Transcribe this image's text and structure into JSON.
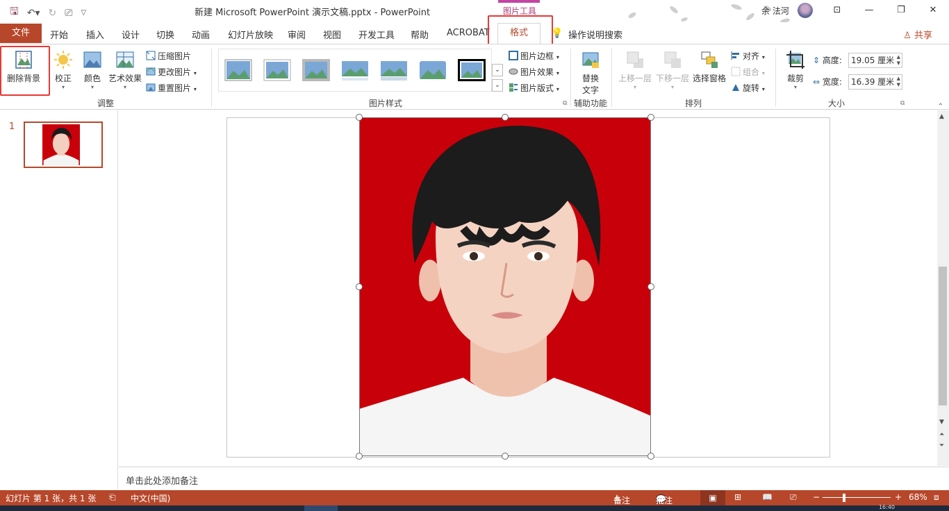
{
  "titlebar": {
    "title": "新建 Microsoft PowerPoint 演示文稿.pptx  -  PowerPoint",
    "context_group": "图片工具",
    "user": "余 法河",
    "qat": {
      "save": "🖫",
      "undo": "↶▾",
      "redo": "↻",
      "present": "⎚",
      "customize": "▽"
    },
    "window": {
      "options": "⊡",
      "minimize": "—",
      "restore": "❐",
      "close": "✕"
    }
  },
  "tabs": {
    "file": "文件",
    "items": [
      "开始",
      "插入",
      "设计",
      "切换",
      "动画",
      "幻灯片放映",
      "审阅",
      "视图",
      "开发工具",
      "帮助",
      "ACROBAT"
    ],
    "active": "格式",
    "tell_me": "操作说明搜索",
    "share": "共享"
  },
  "ribbon": {
    "adjust": {
      "label": "调整",
      "remove_bg": "删除背景",
      "corrections": "校正",
      "color": "颜色",
      "artistic": "艺术效果",
      "compress": "压缩图片",
      "change": "更改图片",
      "reset": "重置图片"
    },
    "styles": {
      "label": "图片样式",
      "border": "图片边框",
      "effects": "图片效果",
      "layout": "图片版式"
    },
    "accessibility": {
      "label": "辅助功能",
      "alt_text_1": "替换",
      "alt_text_2": "文字"
    },
    "arrange": {
      "label": "排列",
      "bring_forward": "上移一层",
      "send_backward": "下移一层",
      "selection_pane": "选择窗格",
      "align": "对齐",
      "group": "组合",
      "rotate": "旋转"
    },
    "size": {
      "label": "大小",
      "crop": "裁剪",
      "height_label": "高度:",
      "height_value": "19.05 厘米",
      "width_label": "宽度:",
      "width_value": "16.39 厘米"
    }
  },
  "slides_panel": {
    "slide_number": "1"
  },
  "notes": {
    "placeholder": "单击此处添加备注"
  },
  "status": {
    "slide_info": "幻灯片 第 1 张，共 1 张",
    "language": "中文(中国)",
    "notes": "备注",
    "comments": "批注",
    "zoom": "68%",
    "minus": "−",
    "plus": "+",
    "clock": "16:40"
  },
  "colors": {
    "accent": "#b7472a",
    "photo_bg": "#c8000a",
    "highlight": "#e53935"
  }
}
